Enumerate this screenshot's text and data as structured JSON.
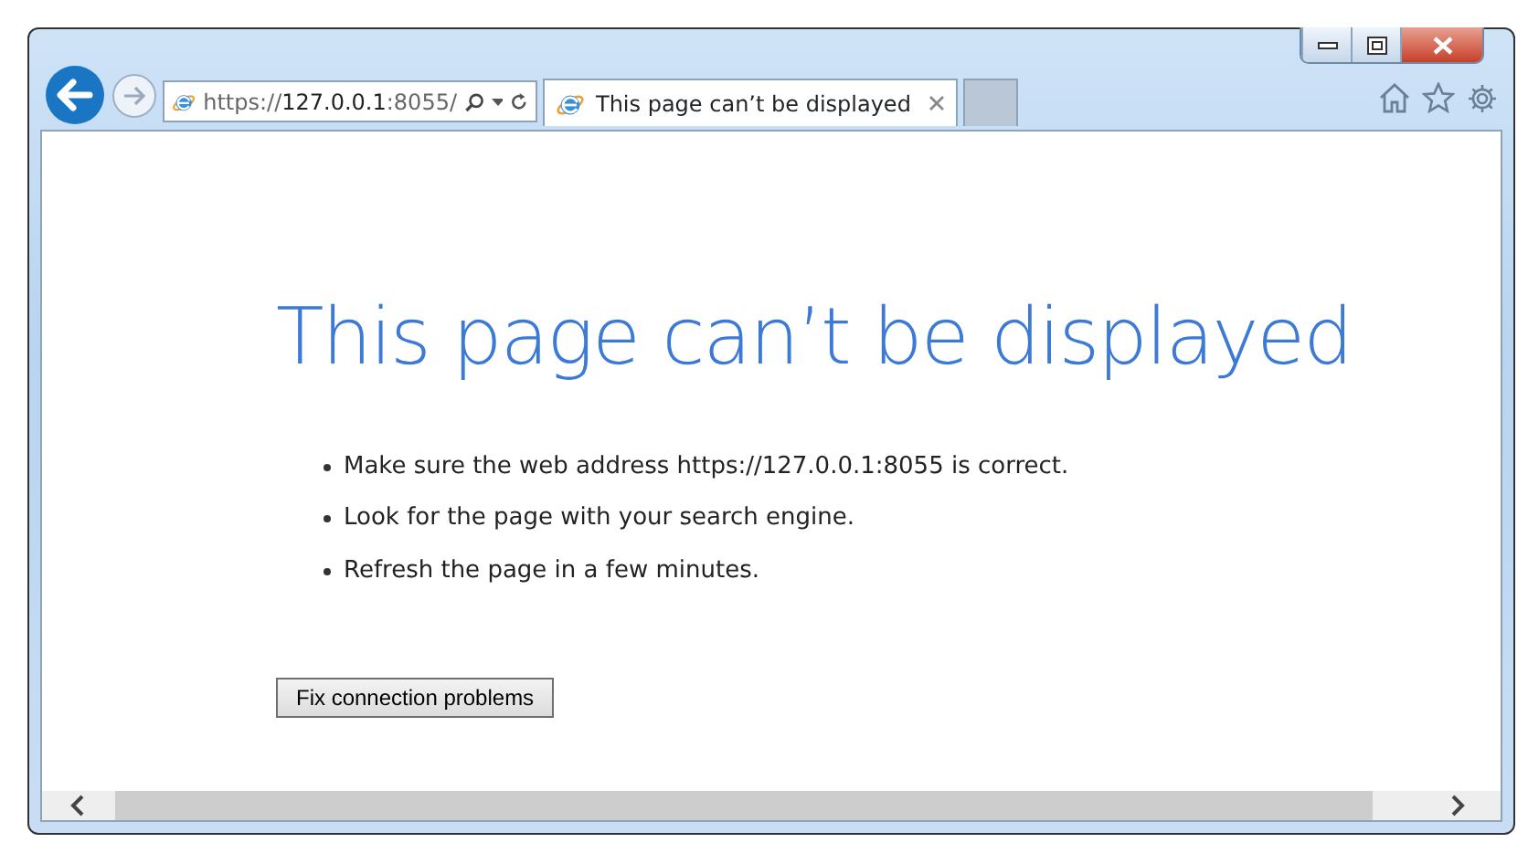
{
  "window": {
    "address_bar": {
      "url": "https://**127.0.0.1**:8055/"
    },
    "tabs": [
      {
        "label": "This page can’t be displayed",
        "selected": true
      }
    ]
  },
  "page": {
    "heading": "This page can’t be displayed",
    "bullets": [
      "Make sure the web address https://127.0.0.1:8055 is correct.",
      "Look for the page with your search engine.",
      "Refresh the page in a few minutes."
    ],
    "button": "Fix connection problems"
  }
}
